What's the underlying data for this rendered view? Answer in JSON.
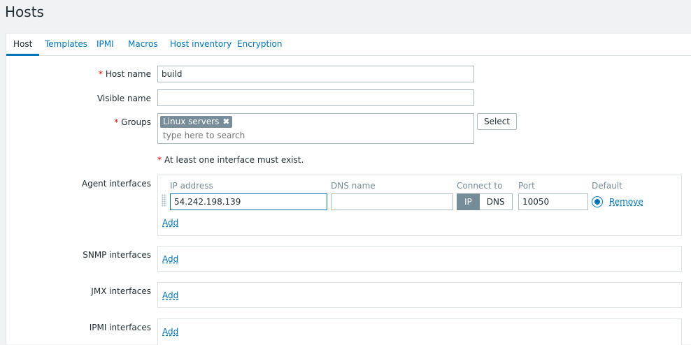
{
  "page": {
    "title": "Hosts"
  },
  "tabs": [
    {
      "label": "Host",
      "active": true
    },
    {
      "label": "Templates"
    },
    {
      "label": "IPMI"
    },
    {
      "label": "Macros"
    },
    {
      "label": "Host inventory"
    },
    {
      "label": "Encryption"
    }
  ],
  "form": {
    "required_mark": "*",
    "host_name": {
      "label": "Host name",
      "value": "build"
    },
    "visible_name": {
      "label": "Visible name",
      "value": ""
    },
    "groups": {
      "label": "Groups",
      "chips": [
        "Linux servers"
      ],
      "chip_remove_glyph": "✖",
      "placeholder": "type here to search",
      "select_button": "Select"
    },
    "warning": "At least one interface must exist.",
    "agent_interfaces": {
      "label": "Agent interfaces",
      "headers": {
        "ip": "IP address",
        "dns": "DNS name",
        "connect_to": "Connect to",
        "port": "Port",
        "default": "Default"
      },
      "row": {
        "ip": "54.242.198.139",
        "dns": "",
        "connect_ip": "IP",
        "connect_dns": "DNS",
        "port": "10050",
        "remove": "Remove"
      },
      "add": "Add"
    },
    "snmp_interfaces": {
      "label": "SNMP interfaces",
      "add": "Add"
    },
    "jmx_interfaces": {
      "label": "JMX interfaces",
      "add": "Add"
    },
    "ipmi_interfaces": {
      "label": "IPMI interfaces",
      "add": "Add"
    }
  },
  "colors": {
    "accent": "#0275b8",
    "required": "#d40000",
    "chip_bg": "#768d99"
  }
}
